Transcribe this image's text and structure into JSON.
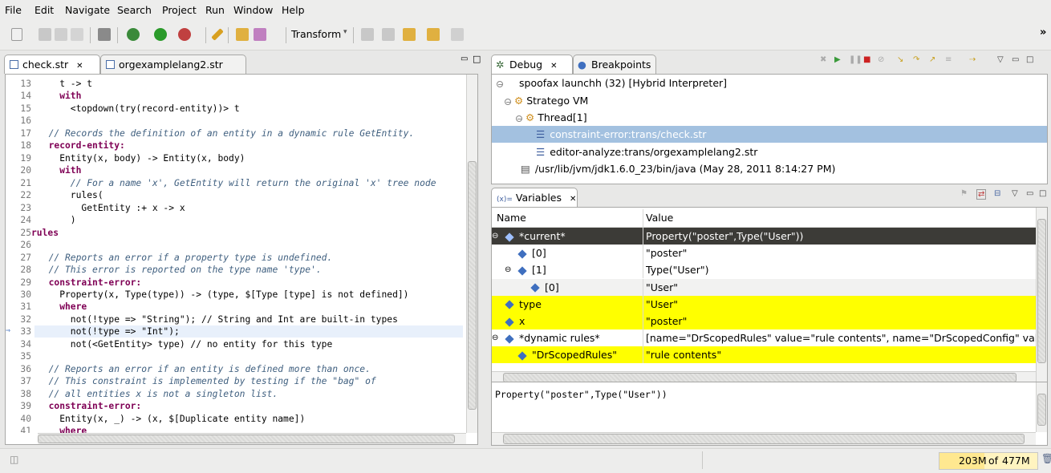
{
  "menu": [
    "File",
    "Edit",
    "Navigate",
    "Search",
    "Project",
    "Run",
    "Window",
    "Help"
  ],
  "toolbar": {
    "transform_label": "Transform",
    "overflow": "»"
  },
  "editor": {
    "tabs": [
      {
        "label": "check.str",
        "close": "✕"
      },
      {
        "label": "orgexamplelang2.str"
      }
    ],
    "lines": [
      {
        "n": "13",
        "t": "    t -> t"
      },
      {
        "n": "14",
        "t": "    with"
      },
      {
        "n": "15",
        "t": "      <topdown(try(record-entity))> t"
      },
      {
        "n": "16",
        "t": ""
      },
      {
        "n": "17",
        "t": "  // Records the definition of an entity in a dynamic rule GetEntity."
      },
      {
        "n": "18",
        "t": "  record-entity:"
      },
      {
        "n": "19",
        "t": "    Entity(x, body) -> Entity(x, body)"
      },
      {
        "n": "20",
        "t": "    with"
      },
      {
        "n": "21",
        "t": "      // For a name 'x', GetEntity will return the original 'x' tree node"
      },
      {
        "n": "22",
        "t": "      rules("
      },
      {
        "n": "23",
        "t": "        GetEntity :+ x -> x"
      },
      {
        "n": "24",
        "t": "      )"
      },
      {
        "n": "25",
        "t": "rules"
      },
      {
        "n": "26",
        "t": ""
      },
      {
        "n": "27",
        "t": "  // Reports an error if a property type is undefined."
      },
      {
        "n": "28",
        "t": "  // This error is reported on the type name 'type'."
      },
      {
        "n": "29",
        "t": "  constraint-error:"
      },
      {
        "n": "30",
        "t": "    Property(x, Type(type)) -> (type, $[Type [type] is not defined])"
      },
      {
        "n": "31",
        "t": "    where"
      },
      {
        "n": "32",
        "t": "      not(!type => \"String\"); // String and Int are built-in types"
      },
      {
        "n": "33",
        "t": "      not(!type => \"Int\");"
      },
      {
        "n": "34",
        "t": "      not(<GetEntity> type) // no entity for this type"
      },
      {
        "n": "35",
        "t": ""
      },
      {
        "n": "36",
        "t": "  // Reports an error if an entity is defined more than once."
      },
      {
        "n": "37",
        "t": "  // This constraint is implemented by testing if the \"bag\" of"
      },
      {
        "n": "38",
        "t": "  // all entities x is not a singleton list."
      },
      {
        "n": "39",
        "t": "  constraint-error:"
      },
      {
        "n": "40",
        "t": "    Entity(x, _) -> (x, $[Duplicate entity name])"
      },
      {
        "n": "41",
        "t": "    where"
      }
    ]
  },
  "debug": {
    "tabs": [
      {
        "label": "Debug",
        "close": "✕"
      },
      {
        "label": "Breakpoints"
      }
    ],
    "items": [
      "spoofax launchh (32) [Hybrid Interpreter]",
      "Stratego VM",
      "Thread[1]",
      "constraint-error:trans/check.str",
      "editor-analyze:trans/orgexamplelang2.str",
      "/usr/lib/jvm/jdk1.6.0_23/bin/java (May 28, 2011 8:14:27 PM)"
    ]
  },
  "variables": {
    "tab_label": "Variables",
    "tab_close": "✕",
    "col_name": "Name",
    "col_value": "Value",
    "rows": [
      {
        "name": "*current*",
        "value": "Property(\"poster\",Type(\"User\"))",
        "level": 0,
        "toggle": "⊖",
        "style": "selected"
      },
      {
        "name": "[0]",
        "value": "\"poster\"",
        "level": 1,
        "toggle": "",
        "style": "normal"
      },
      {
        "name": "[1]",
        "value": "Type(\"User\")",
        "level": 1,
        "toggle": "⊖",
        "style": "normal"
      },
      {
        "name": "[0]",
        "value": "\"User\"",
        "level": 2,
        "toggle": "",
        "style": "alt"
      },
      {
        "name": "type",
        "value": "\"User\"",
        "level": 0,
        "toggle": "",
        "style": "yellow"
      },
      {
        "name": "x",
        "value": "\"poster\"",
        "level": 0,
        "toggle": "",
        "style": "yellow"
      },
      {
        "name": "*dynamic rules*",
        "value": "[name=\"DrScopedRules\" value=\"rule contents\", name=\"DrScopedConfig\" valu",
        "level": 0,
        "toggle": "⊖",
        "style": "normal"
      },
      {
        "name": "\"DrScopedRules\"",
        "value": "\"rule contents\"",
        "level": 1,
        "toggle": "",
        "style": "yellow"
      }
    ],
    "detail": "Property(\"poster\",Type(\"User\"))"
  },
  "status": {
    "heap_used": "203M",
    "heap_of": "of",
    "heap_total": "477M"
  },
  "colors": {
    "selection": "#3c3b37",
    "highlight": "#ffff00",
    "current_frame": "#a3c1e0",
    "current_line": "#e8f0fb"
  }
}
